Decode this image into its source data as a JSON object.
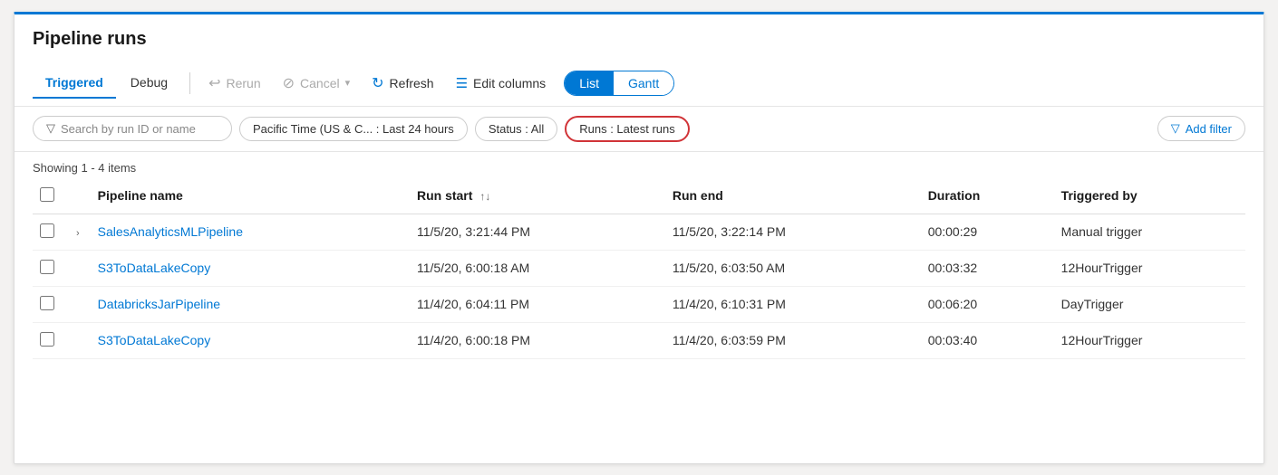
{
  "page": {
    "title": "Pipeline runs"
  },
  "toolbar": {
    "tabs": [
      {
        "id": "triggered",
        "label": "Triggered",
        "active": true
      },
      {
        "id": "debug",
        "label": "Debug",
        "active": false
      }
    ],
    "buttons": [
      {
        "id": "rerun",
        "label": "Rerun",
        "icon": "↩",
        "disabled": true
      },
      {
        "id": "cancel",
        "label": "Cancel",
        "icon": "⊘",
        "disabled": true,
        "hasDropdown": true
      },
      {
        "id": "refresh",
        "label": "Refresh",
        "icon": "↻",
        "disabled": false
      },
      {
        "id": "edit-columns",
        "label": "Edit columns",
        "icon": "☰",
        "disabled": false
      }
    ],
    "toggle": {
      "options": [
        {
          "id": "list",
          "label": "List",
          "active": true
        },
        {
          "id": "gantt",
          "label": "Gantt",
          "active": false
        }
      ]
    }
  },
  "filters": {
    "search_placeholder": "Search by run ID or name",
    "time_filter": "Pacific Time (US & C...  :  Last 24 hours",
    "status_filter": "Status : All",
    "runs_filter": "Runs : Latest runs",
    "add_filter_label": "Add filter"
  },
  "table": {
    "showing_text": "Showing 1 - 4 items",
    "columns": [
      {
        "id": "pipeline_name",
        "label": "Pipeline name",
        "sortable": false
      },
      {
        "id": "run_start",
        "label": "Run start",
        "sortable": true
      },
      {
        "id": "run_end",
        "label": "Run end",
        "sortable": false
      },
      {
        "id": "duration",
        "label": "Duration",
        "sortable": false
      },
      {
        "id": "triggered_by",
        "label": "Triggered by",
        "sortable": false
      }
    ],
    "rows": [
      {
        "id": "row1",
        "expandable": true,
        "pipeline_name": "SalesAnalyticsMLPipeline",
        "run_start": "11/5/20, 3:21:44 PM",
        "run_end": "11/5/20, 3:22:14 PM",
        "duration": "00:00:29",
        "triggered_by": "Manual trigger"
      },
      {
        "id": "row2",
        "expandable": false,
        "pipeline_name": "S3ToDataLakeCopy",
        "run_start": "11/5/20, 6:00:18 AM",
        "run_end": "11/5/20, 6:03:50 AM",
        "duration": "00:03:32",
        "triggered_by": "12HourTrigger"
      },
      {
        "id": "row3",
        "expandable": false,
        "pipeline_name": "DatabricksJarPipeline",
        "run_start": "11/4/20, 6:04:11 PM",
        "run_end": "11/4/20, 6:10:31 PM",
        "duration": "00:06:20",
        "triggered_by": "DayTrigger"
      },
      {
        "id": "row4",
        "expandable": false,
        "pipeline_name": "S3ToDataLakeCopy",
        "run_start": "11/4/20, 6:00:18 PM",
        "run_end": "11/4/20, 6:03:59 PM",
        "duration": "00:03:40",
        "triggered_by": "12HourTrigger"
      }
    ]
  }
}
